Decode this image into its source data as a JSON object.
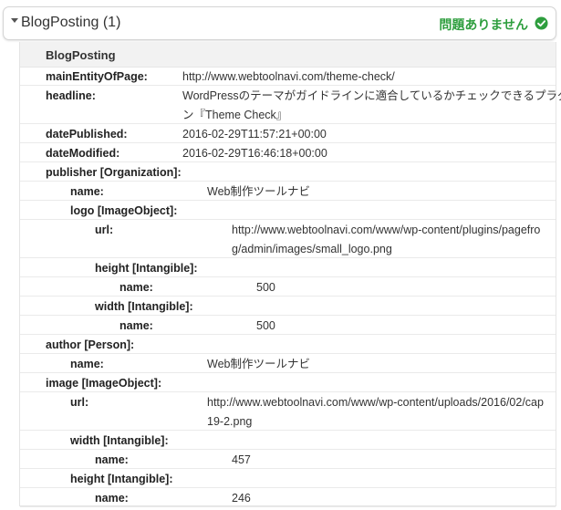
{
  "header": {
    "title": "BlogPosting (1)",
    "status": "問題ありません",
    "status_color": "#2e9e3e",
    "expand_icon": "caret-down-icon",
    "status_icon": "check-circle-icon"
  },
  "type_label": "BlogPosting",
  "rows": [
    {
      "key": "mainEntityOfPage:",
      "value": [
        "http://www.webtoolnavi.com/theme-check/"
      ],
      "level": 0
    },
    {
      "key": "headline:",
      "value": [
        "WordPressのテーマがガイドラインに適合しているかチェックできるプラグイ",
        "ン『Theme Check』"
      ],
      "level": 0
    },
    {
      "key": "datePublished:",
      "value": [
        "2016-02-29T11:57:21+00:00"
      ],
      "level": 0
    },
    {
      "key": "dateModified:",
      "value": [
        "2016-02-29T16:46:18+00:00"
      ],
      "level": 0
    },
    {
      "key": "publisher [Organization]:",
      "value": [],
      "level": 0
    },
    {
      "key": "name:",
      "value": [
        "Web制作ツールナビ"
      ],
      "level": 1
    },
    {
      "key": "logo [ImageObject]:",
      "value": [],
      "level": 1
    },
    {
      "key": "url:",
      "value": [
        "http://www.webtoolnavi.com/www/wp-content/plugins/pagefro",
        "g/admin/images/small_logo.png"
      ],
      "level": 2
    },
    {
      "key": "height [Intangible]:",
      "value": [],
      "level": 2
    },
    {
      "key": "name:",
      "value": [
        "500"
      ],
      "level": 3
    },
    {
      "key": "width [Intangible]:",
      "value": [],
      "level": 2
    },
    {
      "key": "name:",
      "value": [
        "500"
      ],
      "level": 3
    },
    {
      "key": "author [Person]:",
      "value": [],
      "level": 0
    },
    {
      "key": "name:",
      "value": [
        "Web制作ツールナビ"
      ],
      "level": 1
    },
    {
      "key": "image [ImageObject]:",
      "value": [],
      "level": 0
    },
    {
      "key": "url:",
      "value": [
        "http://www.webtoolnavi.com/www/wp-content/uploads/2016/02/cap",
        "19-2.png"
      ],
      "level": 1
    },
    {
      "key": "width [Intangible]:",
      "value": [],
      "level": 1
    },
    {
      "key": "name:",
      "value": [
        "457"
      ],
      "level": 2
    },
    {
      "key": "height [Intangible]:",
      "value": [],
      "level": 1
    },
    {
      "key": "name:",
      "value": [
        "246"
      ],
      "level": 2
    }
  ]
}
